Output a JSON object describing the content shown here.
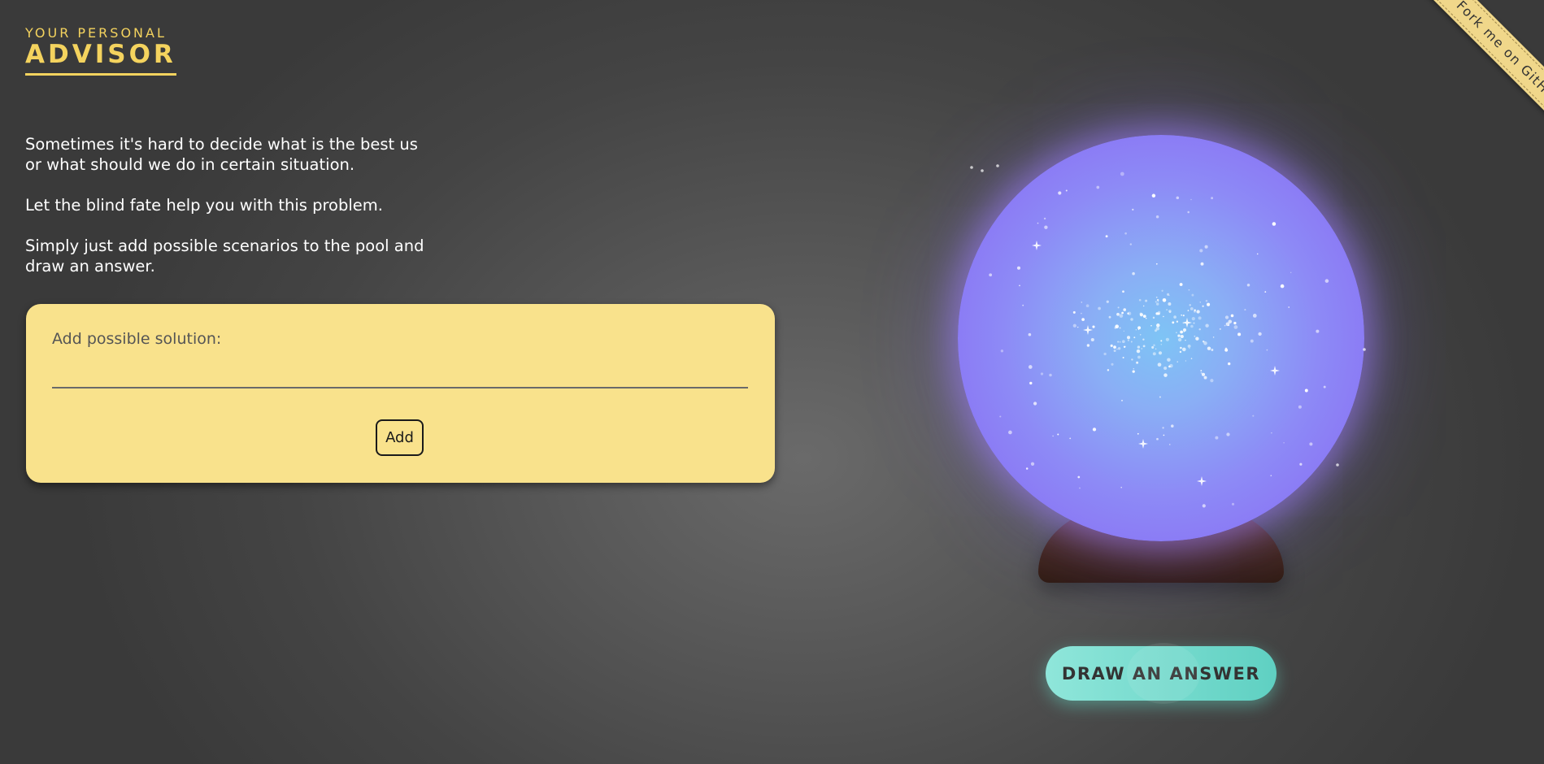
{
  "header": {
    "kicker": "YOUR PERSONAL",
    "title": "ADVISOR"
  },
  "intro": {
    "paragraph_1_line_1": "Sometimes it's hard to decide what is the best us",
    "paragraph_1_line_2": "or what should we do in certain situation.",
    "paragraph_2": "Let the blind fate help you with this problem.",
    "paragraph_3_line_1": "Simply just add possible scenarios to the pool and",
    "paragraph_3_line_2": "draw an answer."
  },
  "form": {
    "label": "Add possible solution:",
    "input_value": "",
    "add_button_label": "Add"
  },
  "draw_button_label": "DRAW AN ANSWER",
  "ribbon_label": "Fork me on GitHub!",
  "colors": {
    "accent_yellow": "#f4d35e",
    "card_background": "#f9e28c",
    "ball_purple": "#8670f3",
    "ball_blue": "#7ec4f5",
    "button_teal": "#6fd8ca",
    "stand_brown": "#3f2416"
  }
}
